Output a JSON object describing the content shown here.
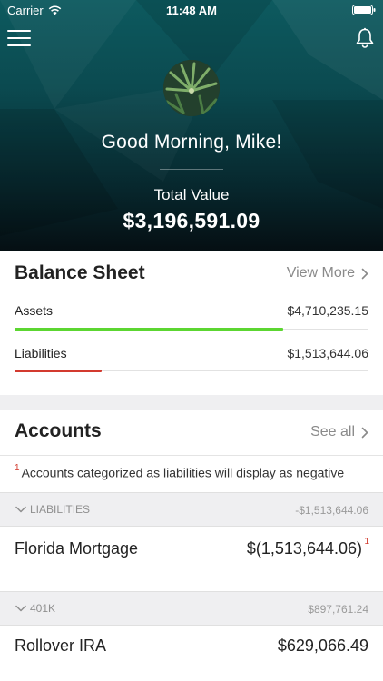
{
  "status_bar": {
    "carrier": "Carrier",
    "time": "11:48 AM"
  },
  "header": {
    "greeting": "Good Morning, Mike!",
    "total_label": "Total Value",
    "total_value": "$3,196,591.09"
  },
  "balance_sheet": {
    "title": "Balance Sheet",
    "link": "View More",
    "rows": [
      {
        "label": "Assets",
        "value": "$4,710,235.15",
        "bar_fraction": 0.76,
        "color": "#5cd631"
      },
      {
        "label": "Liabilities",
        "value": "$1,513,644.06",
        "bar_fraction": 0.245,
        "color": "#d33a2f"
      }
    ]
  },
  "accounts": {
    "title": "Accounts",
    "link": "See all",
    "note_marker": "1",
    "note": "Accounts categorized as liabilities will display as negative",
    "groups": [
      {
        "name": "LIABILITIES",
        "total": "-$1,513,644.06",
        "items": [
          {
            "name": "Florida Mortgage",
            "value": "$(1,513,644.06)",
            "marker": "1"
          }
        ]
      },
      {
        "name": "401K",
        "total": "$897,761.24",
        "items": [
          {
            "name": "Rollover IRA",
            "value": "$629,066.49"
          }
        ]
      }
    ]
  },
  "colors": {
    "accent_green": "#5cd631",
    "accent_red": "#d33a2f",
    "header_teal": "#0d5a5f"
  },
  "icons": [
    "wifi-icon",
    "battery-icon",
    "menu-icon",
    "bell-icon",
    "chevron-right-icon",
    "chevron-down-icon"
  ]
}
